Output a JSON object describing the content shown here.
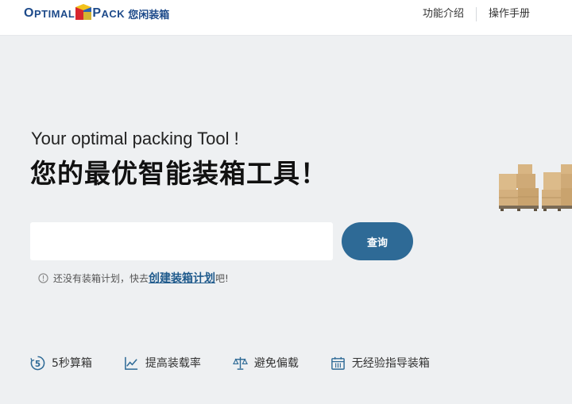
{
  "header": {
    "logo": {
      "text_o": "O",
      "text_ptimal": "PTIMAL",
      "text_p": "P",
      "text_ack": "ACK",
      "text_cn": "您闲装箱",
      "colors": {
        "red": "#d8262e",
        "blue": "#2c61b3",
        "yellow": "#f2c21b"
      }
    },
    "nav": [
      {
        "label": "功能介绍"
      },
      {
        "label": "操作手册"
      }
    ]
  },
  "hero": {
    "subtitle_en": "Your optimal packing Tool !",
    "title_cn": "您的最优智能装箱工具！"
  },
  "search": {
    "value": "",
    "placeholder": "",
    "button_label": "查询"
  },
  "hint": {
    "icon": "info-circle-icon",
    "prefix": "还没有装箱计划，快去",
    "link": "创建装箱计划",
    "suffix": "吧!"
  },
  "features": [
    {
      "icon": "five-seconds-icon",
      "label": "5秒算箱"
    },
    {
      "icon": "trend-chart-icon",
      "label": "提高装载率"
    },
    {
      "icon": "balance-scale-icon",
      "label": "避免偏载"
    },
    {
      "icon": "calendar-grid-icon",
      "label": "无经验指导装箱"
    }
  ],
  "colors": {
    "accent": "#2e6a96",
    "link": "#1f5a8c",
    "background": "#eef0f2",
    "header_bg": "#ffffff"
  }
}
